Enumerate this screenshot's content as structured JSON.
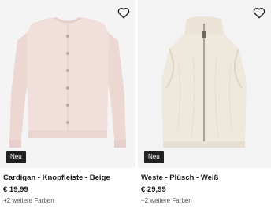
{
  "products": [
    {
      "badge": "Neu",
      "title": "Cardigan - Knopfleiste - Beige",
      "price": "€ 19,99",
      "more_colors": "+2 weitere Farben",
      "garment_color": "#f1dfdc",
      "favorite_icon": "heart-outline-icon"
    },
    {
      "badge": "Neu",
      "title": "Weste - Plüsch - Weiß",
      "price": "€ 29,99",
      "more_colors": "+2 weitere Farben",
      "garment_color": "#efe8dc",
      "favorite_icon": "heart-outline-icon"
    }
  ]
}
